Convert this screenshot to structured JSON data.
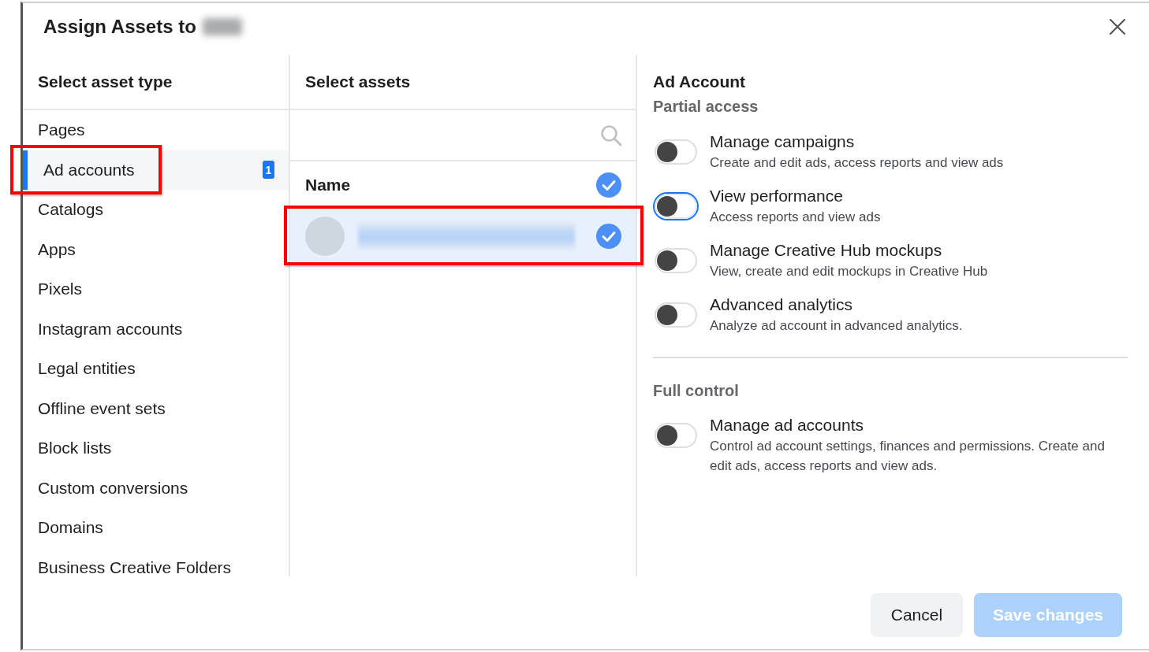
{
  "dialog": {
    "title": "Assign Assets to",
    "title_redacted": true
  },
  "sidebar": {
    "heading": "Select asset type",
    "items": [
      {
        "label": "Pages",
        "selected": false,
        "highlighted": false
      },
      {
        "label": "Ad accounts",
        "selected": true,
        "highlighted": true,
        "badge": "1"
      },
      {
        "label": "Catalogs",
        "selected": false,
        "highlighted": false
      },
      {
        "label": "Apps",
        "selected": false,
        "highlighted": false
      },
      {
        "label": "Pixels",
        "selected": false,
        "highlighted": false
      },
      {
        "label": "Instagram accounts",
        "selected": false,
        "highlighted": false
      },
      {
        "label": "Legal entities",
        "selected": false,
        "highlighted": false
      },
      {
        "label": "Offline event sets",
        "selected": false,
        "highlighted": false
      },
      {
        "label": "Block lists",
        "selected": false,
        "highlighted": false
      },
      {
        "label": "Custom conversions",
        "selected": false,
        "highlighted": false
      },
      {
        "label": "Domains",
        "selected": false,
        "highlighted": false
      },
      {
        "label": "Business Creative Folders",
        "selected": false,
        "highlighted": false
      }
    ]
  },
  "assets": {
    "heading": "Select assets",
    "name_header": {
      "label": "Name",
      "checked": true
    },
    "rows": [
      {
        "redacted": true,
        "checked": true,
        "selected": true,
        "highlighted": true
      }
    ]
  },
  "permissions": {
    "title": "Ad Account",
    "groups": [
      {
        "label": "Partial access",
        "options": [
          {
            "title": "Manage campaigns",
            "description": "Create and edit ads, access reports and view ads",
            "on": false,
            "focused": false
          },
          {
            "title": "View performance",
            "description": "Access reports and view ads",
            "on": false,
            "focused": true
          },
          {
            "title": "Manage Creative Hub mockups",
            "description": "View, create and edit mockups in Creative Hub",
            "on": false,
            "focused": false
          },
          {
            "title": "Advanced analytics",
            "description": "Analyze ad account in advanced analytics.",
            "on": false,
            "focused": false
          }
        ]
      },
      {
        "label": "Full control",
        "options": [
          {
            "title": "Manage ad accounts",
            "description": "Control ad account settings, finances and permissions. Create and edit ads, access reports and view ads.",
            "on": false,
            "focused": false
          }
        ]
      }
    ]
  },
  "buttons": [
    {
      "label": "Cancel",
      "kind": "secondary",
      "disabled": false
    },
    {
      "label": "Save changes",
      "kind": "primary",
      "disabled": true
    }
  ]
}
